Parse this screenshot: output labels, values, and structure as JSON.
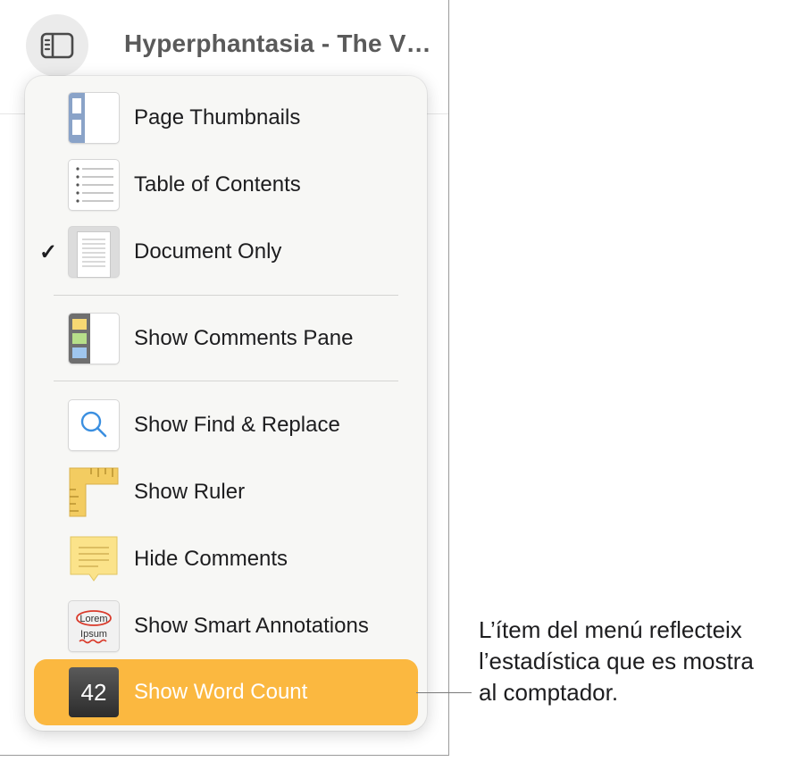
{
  "window": {
    "title": "Hyperphantasia - The V…"
  },
  "menu": {
    "items": [
      {
        "label": "Page Thumbnails",
        "icon": "page-thumbnails-icon",
        "checked": false
      },
      {
        "label": "Table of Contents",
        "icon": "table-of-contents-icon",
        "checked": false
      },
      {
        "label": "Document Only",
        "icon": "document-only-icon",
        "checked": true
      },
      {
        "label": "Show Comments Pane",
        "icon": "comments-pane-icon",
        "checked": false
      },
      {
        "label": "Show Find & Replace",
        "icon": "magnifier-icon",
        "checked": false
      },
      {
        "label": "Show Ruler",
        "icon": "ruler-icon",
        "checked": false
      },
      {
        "label": "Hide Comments",
        "icon": "sticky-note-icon",
        "checked": false
      },
      {
        "label": "Show Smart Annotations",
        "icon": "smart-annotations-icon",
        "checked": false
      },
      {
        "label": "Show Word Count",
        "icon": "word-count-icon",
        "checked": false,
        "highlighted": true
      }
    ],
    "checkmark": "✓",
    "annotation_icon_text": {
      "line1": "Lorem",
      "line2": "Ipsum"
    },
    "word_count_badge": "42"
  },
  "callout": {
    "lines": [
      "L’ítem del menú reflecteix",
      "l’estadística que es mostra",
      "al comptador."
    ]
  },
  "colors": {
    "highlight": "#fbb840",
    "menu_bg": "#f7f7f5",
    "title_gray": "#5a5a5a"
  }
}
